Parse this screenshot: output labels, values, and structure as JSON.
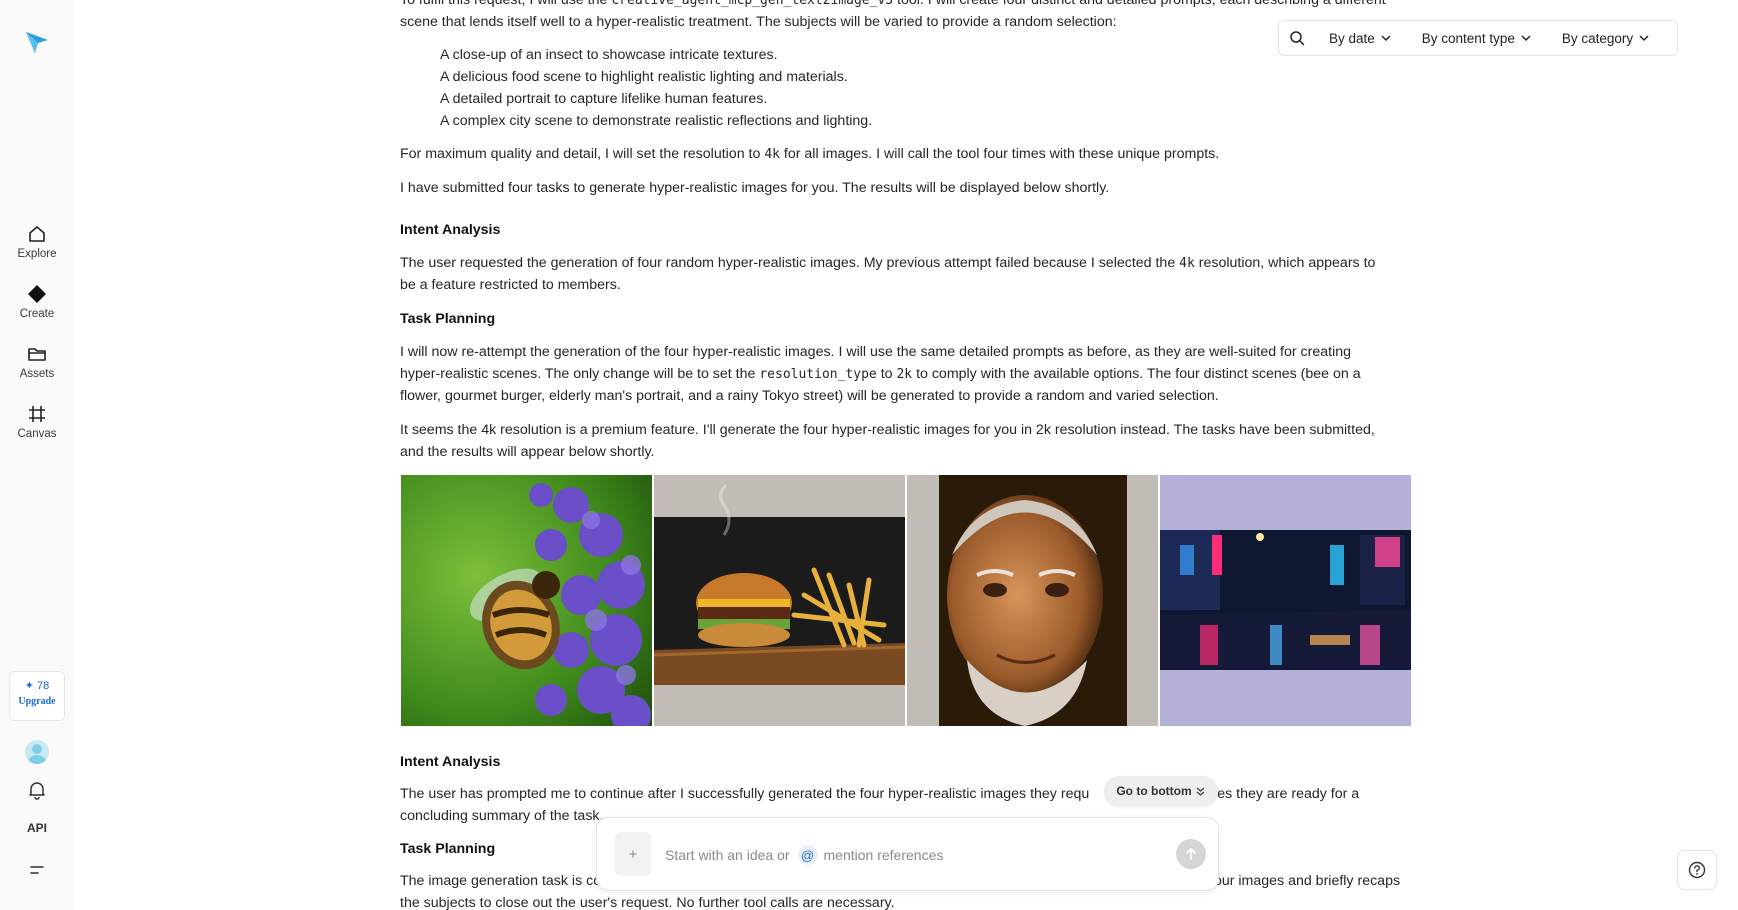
{
  "sidebar": {
    "nav": [
      {
        "label": "Explore",
        "icon": "home-icon"
      },
      {
        "label": "Create",
        "icon": "diamond-icon"
      },
      {
        "label": "Assets",
        "icon": "folder-icon"
      },
      {
        "label": "Canvas",
        "icon": "frame-icon"
      }
    ],
    "credits": "78",
    "upgrade_label": "Upgrade",
    "api_label": "API"
  },
  "filters": {
    "by_date": "By date",
    "by_content_type": "By content type",
    "by_category": "By category"
  },
  "content": {
    "intro_top": {
      "pre": "To fulfil this request, I will use the ",
      "code": "creative_agent_mcp_gen_text2image_v3",
      "post": " tool. I will create four distinct and detailed prompts, each describing a different"
    },
    "intro_line2": "scene that lends itself well to a hyper-realistic treatment. The subjects will be varied to provide a random selection:",
    "list_items": [
      "A close-up of an insect to showcase intricate textures.",
      "A delicious food scene to highlight realistic lighting and materials.",
      "A detailed portrait to capture lifelike human features.",
      "A complex city scene to demonstrate realistic reflections and lighting."
    ],
    "resolution_note": {
      "pre": "For maximum quality and detail, I will set the resolution to ",
      "code": "4k",
      "post": " for all images. I will call the tool four times with these unique prompts."
    },
    "submitted_note": "I have submitted four tasks to generate hyper-realistic images for you. The results will be displayed below shortly.",
    "intent_heading_1": "Intent Analysis",
    "intent_text_1": {
      "pre": "The user requested the generation of four random hyper-realistic images. My previous attempt failed because I selected the ",
      "code": "4k",
      "post": " resolution, which appears to",
      "line2": "be a feature restricted to members."
    },
    "task_heading_1": "Task Planning",
    "task_text_1": {
      "line1": "I will now re-attempt the generation of the four hyper-realistic images. I will use the same detailed prompts as before, as they are well-suited for creating",
      "line2_pre": "hyper-realistic scenes. The only change will be to set the ",
      "line2_code1": "resolution_type",
      "line2_mid": " to ",
      "line2_code2": "2k",
      "line2_post": " to comply with the available options. The four distinct scenes (bee on a",
      "line3": "flower, gourmet burger, elderly man's portrait, and a rainy Tokyo street) will be generated to provide a random and varied selection."
    },
    "premium_note": {
      "line1": "It seems the 4k resolution is a premium feature. I'll generate the four hyper-realistic images for you in 2k resolution instead. The tasks have been submitted,",
      "line2": "and the results will appear below shortly."
    },
    "images": [
      {
        "subject": "bee on purple flower"
      },
      {
        "subject": "burger with fries"
      },
      {
        "subject": "elderly man portrait"
      },
      {
        "subject": "rainy neon city street"
      }
    ],
    "intent_heading_2": "Intent Analysis",
    "intent_text_2": {
      "line1": "The user has prompted me to continue after I successfully generated the four hyper-realistic images they requ",
      "line1_tail": "es they are ready for a",
      "line2": "concluding summary of the task."
    },
    "task_heading_2": "Task Planning",
    "task_text_2": {
      "line1_pre": "The image generation task is co",
      "line1_tail": "four images and briefly recaps",
      "line2": "the subjects to close out the user's request. No further tool calls are necessary."
    }
  },
  "go_to_bottom": "Go to bottom",
  "composer": {
    "placeholder_pre": "Start with an idea or",
    "at_symbol": "@",
    "placeholder_post": "mention references",
    "attach_symbol": "+"
  },
  "colors": {
    "accent": "#1769d6",
    "sidebar_bg": "#fafafa"
  }
}
